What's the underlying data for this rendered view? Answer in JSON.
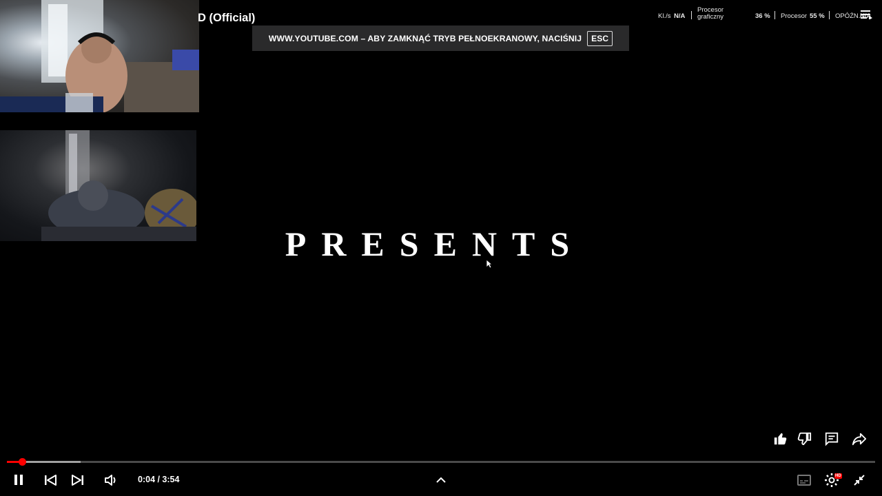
{
  "video": {
    "title_fragment": "D (Official)",
    "overlay_text": "PRESENTS",
    "time_current": "0:04",
    "time_total": "3:54",
    "time_display": "0:04 / 3:54",
    "progress_fraction": 0.0171,
    "buffered_fraction": 0.085,
    "quality_badge": "HD"
  },
  "fullscreen_notice": {
    "text": "WWW.YOUTUBE.COM – ABY ZAMKNĄĆ TRYB PEŁNOEKRANOWY, NACIŚNIJ",
    "key": "ESC"
  },
  "stats_overlay": {
    "fps_label": "Kl./s",
    "fps_value": "N/A",
    "gpu_label_line1": "Procesor",
    "gpu_label_line2": "graficzny",
    "gpu_value": "36 %",
    "cpu_label": "Procesor",
    "cpu_value": "55 %",
    "latency_label": "OPÓŹN.",
    "latency_value": "N/A"
  },
  "icons": {
    "like": "thumbs-up-icon",
    "dislike": "thumbs-down-icon",
    "comments": "comment-icon",
    "share": "share-icon",
    "pause": "pause-icon",
    "previous": "skip-previous-icon",
    "next": "skip-next-icon",
    "volume": "volume-icon",
    "expand": "chevron-up-icon",
    "subtitles": "subtitles-icon",
    "settings": "gear-icon",
    "exit_fullscreen": "exit-fullscreen-icon",
    "menu": "menu-icon"
  },
  "colors": {
    "progress": "#ff0000",
    "background": "#000000",
    "notice_bg": "#2a2a2b"
  }
}
